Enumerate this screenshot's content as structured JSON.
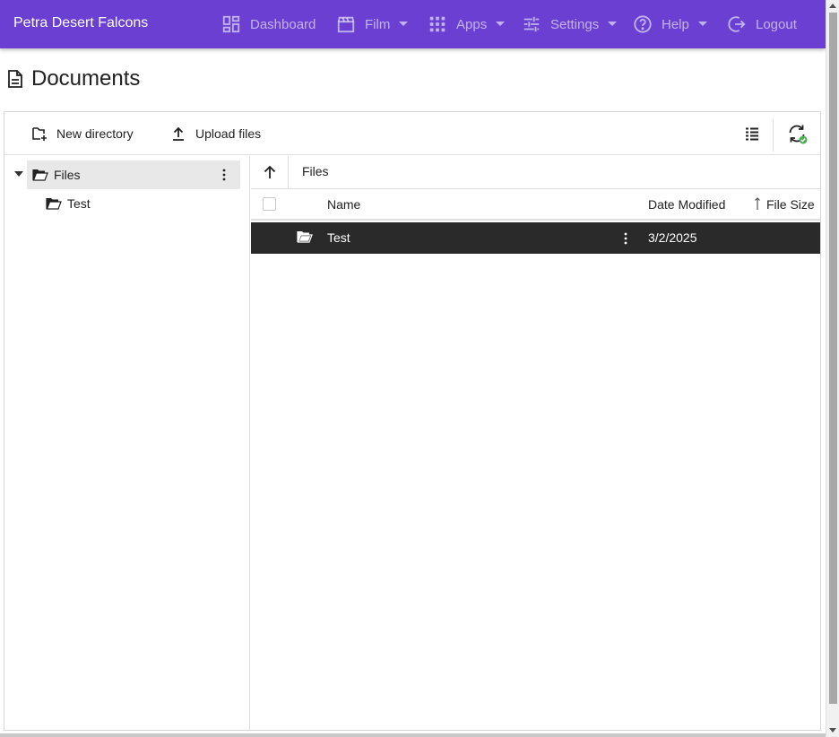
{
  "nav": {
    "brand": "Petra Desert Falcons",
    "items": [
      {
        "label": "Dashboard",
        "icon": "dashboard-icon",
        "dropdown": false
      },
      {
        "label": "Film",
        "icon": "clapperboard-icon",
        "dropdown": true
      },
      {
        "label": "Apps",
        "icon": "apps-grid-icon",
        "dropdown": true
      },
      {
        "label": "Settings",
        "icon": "sliders-icon",
        "dropdown": true
      },
      {
        "label": "Help",
        "icon": "help-circle-icon",
        "dropdown": true
      },
      {
        "label": "Logout",
        "icon": "logout-icon",
        "dropdown": false
      }
    ]
  },
  "page": {
    "title": "Documents",
    "icon": "document-icon"
  },
  "toolbar": {
    "new_directory": "New directory",
    "upload_files": "Upload files",
    "view_toggle_icon": "list-view-icon",
    "refresh_icon": "refresh-sync-icon"
  },
  "tree": {
    "root": {
      "label": "Files",
      "expanded": true
    },
    "children": [
      {
        "label": "Test"
      }
    ]
  },
  "content": {
    "path": "Files",
    "columns": {
      "name": "Name",
      "date": "Date Modified",
      "size": "File Size"
    },
    "rows": [
      {
        "name": "Test",
        "date": "3/2/2025",
        "size": "",
        "type": "folder",
        "selected": true
      }
    ]
  },
  "colors": {
    "nav_bg": "#6a3fd1",
    "selected_row_bg": "#2a2a2a",
    "tree_selected_bg": "#e8e8e8",
    "refresh_check": "#4caf50"
  }
}
